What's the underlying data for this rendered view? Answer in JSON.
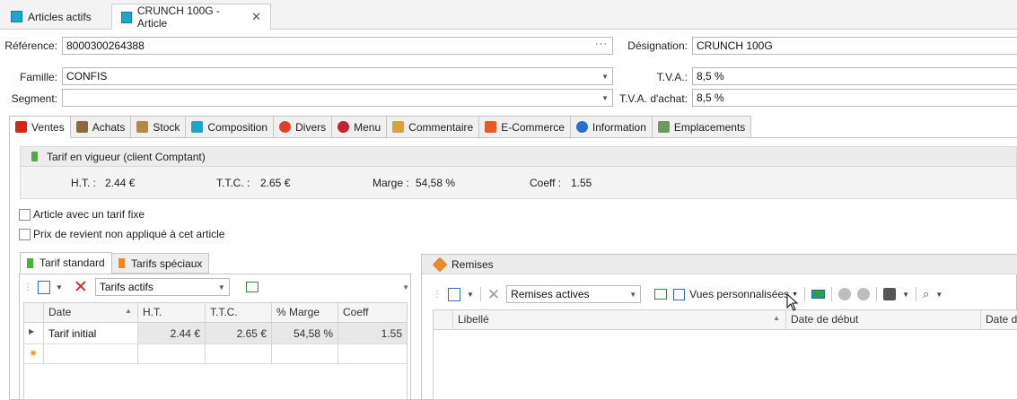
{
  "doc_tabs": [
    {
      "label": "Articles actifs"
    },
    {
      "label": "CRUNCH  100G - Article"
    }
  ],
  "form": {
    "reference_label": "Référence:",
    "reference_value": "8000300264388",
    "famille_label": "Famille:",
    "famille_value": "CONFIS",
    "segment_label": "Segment:",
    "segment_value": "",
    "designation_label": "Désignation:",
    "designation_value": "CRUNCH  100G",
    "tva_label": "T.V.A.:",
    "tva_value": "8,5 %",
    "tva_achat_label": "T.V.A. d'achat:",
    "tva_achat_value": "8,5 %"
  },
  "tabs": [
    {
      "label": "Ventes",
      "icon": "ventes-icon",
      "color": "#d9241b"
    },
    {
      "label": "Achats",
      "icon": "truck-icon",
      "color": "#8a6b3a"
    },
    {
      "label": "Stock",
      "icon": "box-icon",
      "color": "#b08a4a"
    },
    {
      "label": "Composition",
      "icon": "composition-icon",
      "color": "#1ba5c9"
    },
    {
      "label": "Divers",
      "icon": "shapes-icon",
      "color": "#e0402a"
    },
    {
      "label": "Menu",
      "icon": "menu-icon",
      "color": "#c0262e"
    },
    {
      "label": "Commentaire",
      "icon": "pencil-icon",
      "color": "#d9a23b"
    },
    {
      "label": "E-Commerce",
      "icon": "magento-icon",
      "color": "#e65c1f"
    },
    {
      "label": "Information",
      "icon": "info-icon",
      "color": "#2a6fc9"
    },
    {
      "label": "Emplacements",
      "icon": "emplacement-icon",
      "color": "#6d9a58"
    }
  ],
  "tarif": {
    "header": "Tarif en vigueur (client Comptant)",
    "ht_label": "H.T. :",
    "ht_value": "2.44 €",
    "ttc_label": "T.T.C. :",
    "ttc_value": "2.65 €",
    "marge_label": "Marge :",
    "marge_value": "54,58 %",
    "coeff_label": "Coeff :",
    "coeff_value": "1.55"
  },
  "checkboxes": {
    "tarif_fixe": "Article avec un tarif fixe",
    "prix_revient": "Prix de revient non appliqué à cet article"
  },
  "tarifs_panel": {
    "tab_standard": "Tarif standard",
    "tab_speciaux": "Tarifs spéciaux",
    "filter_value": "Tarifs actifs",
    "columns": [
      "Date",
      "H.T.",
      "T.T.C.",
      "% Marge",
      "Coeff"
    ],
    "rows": [
      {
        "date": "Tarif initial",
        "ht": "2.44 €",
        "ttc": "2.65 €",
        "marge": "54,58 %",
        "coeff": "1.55"
      }
    ]
  },
  "remises_panel": {
    "title": "Remises",
    "filter_value": "Remises actives",
    "vues_label": "Vues personnalisées",
    "columns": [
      "Libellé",
      "Date de début",
      "Date de"
    ]
  },
  "colors": {
    "accent": "#1ba5c9",
    "brand_red": "#d9241b"
  }
}
